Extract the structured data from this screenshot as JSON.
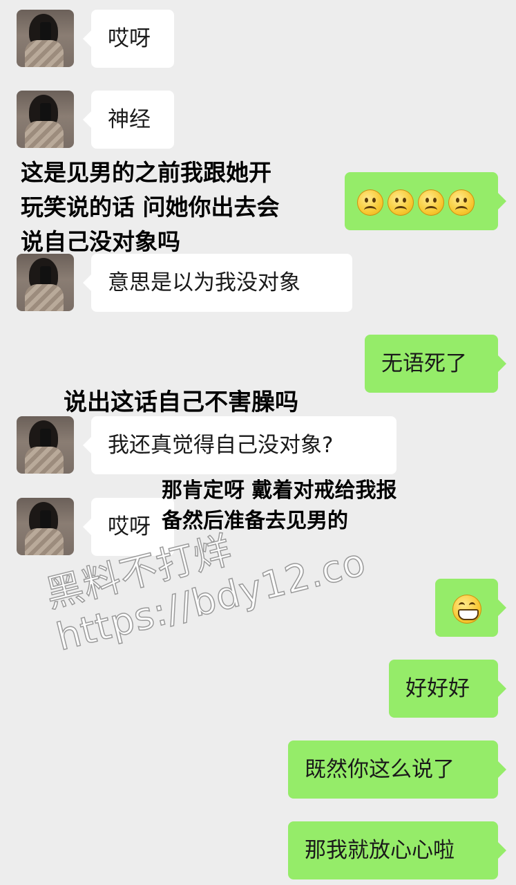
{
  "messages": [
    {
      "side": "left",
      "text": "哎呀"
    },
    {
      "side": "left",
      "text": "神经"
    },
    {
      "side": "right",
      "emoji": [
        "sad-face",
        "sad-face",
        "sad-face",
        "sad-face"
      ]
    },
    {
      "side": "left",
      "text": "意思是以为我没对象"
    },
    {
      "side": "right",
      "text": "无语死了"
    },
    {
      "side": "left",
      "text": "我还真觉得自己没对象?"
    },
    {
      "side": "left",
      "text": "哎呀"
    },
    {
      "side": "right",
      "emoji": [
        "grin-face"
      ]
    },
    {
      "side": "right",
      "text": "好好好"
    },
    {
      "side": "right",
      "text": "既然你这么说了"
    },
    {
      "side": "right",
      "text": "那我就放心心啦"
    }
  ],
  "annotations": {
    "note1": [
      "这是见男的之前我跟她开",
      "玩笑说的话 问她你出去会",
      "说自己没对象吗"
    ],
    "note2": "说出这话自己不害臊吗",
    "note3": [
      "那肯定呀 戴着对戒给我报",
      "备然后准备去见男的"
    ]
  },
  "watermark": {
    "line1": "黑料不打烊",
    "line2": "https://bdy12.co"
  },
  "colors": {
    "background": "#ededed",
    "bubble_left": "#ffffff",
    "bubble_right": "#95ec69"
  }
}
